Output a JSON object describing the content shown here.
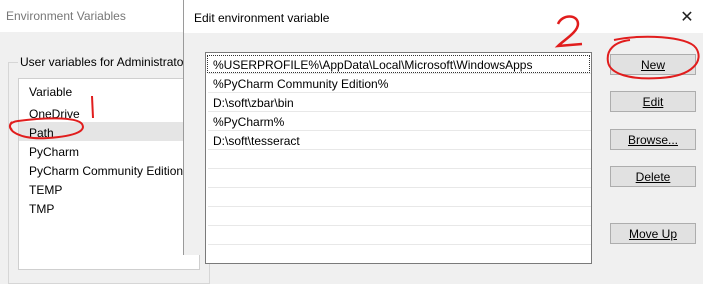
{
  "background_window": {
    "title": "Environment Variables",
    "group_label": "User variables for Administrator",
    "column_header": "Variable",
    "variables": [
      "OneDrive",
      "Path",
      "PyCharm",
      "PyCharm Community Edition",
      "TEMP",
      "TMP"
    ]
  },
  "dialog": {
    "title": "Edit environment variable",
    "close_icon": "close-icon",
    "paths": [
      "%USERPROFILE%\\AppData\\Local\\Microsoft\\WindowsApps",
      "%PyCharm Community Edition%",
      "D:\\soft\\zbar\\bin",
      "%PyCharm%",
      "D:\\soft\\tesseract"
    ],
    "buttons": {
      "new": "New",
      "edit": "Edit",
      "browse": "Browse...",
      "delete": "Delete",
      "move_up": "Move Up"
    }
  },
  "annotations": {
    "step1": "1",
    "step2": "2",
    "color": "#e11d1d"
  }
}
